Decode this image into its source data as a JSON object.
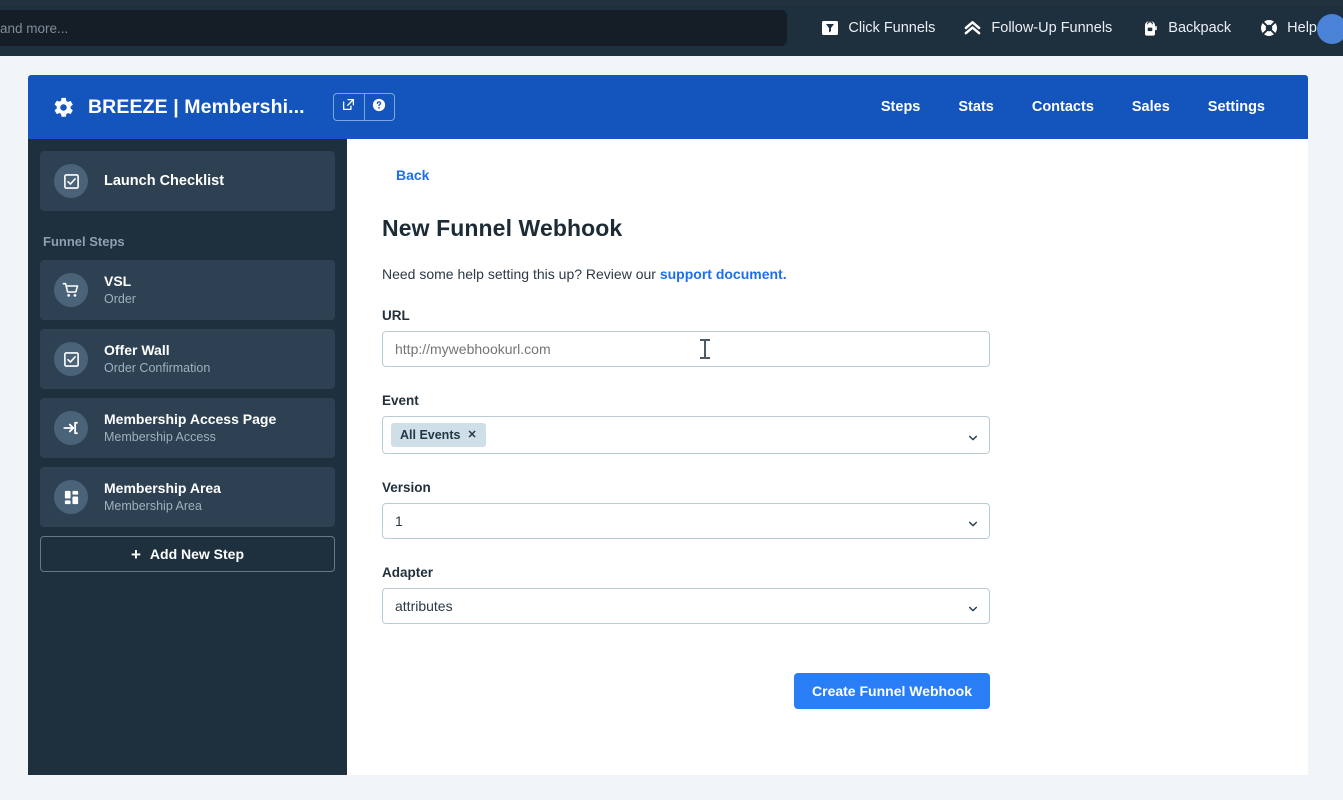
{
  "topbar": {
    "search_placeholder": "and more...",
    "search_value": "",
    "nav": [
      {
        "label": "Click Funnels",
        "icon": "clickfunnels-icon"
      },
      {
        "label": "Follow-Up Funnels",
        "icon": "chevrons-up-icon"
      },
      {
        "label": "Backpack",
        "icon": "backpack-icon"
      },
      {
        "label": "Help",
        "icon": "lifebuoy-icon"
      }
    ]
  },
  "appheader": {
    "title": "BREEZE | Membershi...",
    "gear_icon": "gear-icon",
    "buttons": [
      {
        "name": "open-external-button",
        "icon": "external-link-icon"
      },
      {
        "name": "help-button",
        "icon": "question-circle-icon"
      }
    ],
    "nav": [
      {
        "label": "Steps"
      },
      {
        "label": "Stats"
      },
      {
        "label": "Contacts"
      },
      {
        "label": "Sales"
      },
      {
        "label": "Settings"
      }
    ],
    "accent_color": "#1455bd"
  },
  "sidebar": {
    "launch_checklist": {
      "label": "Launch Checklist",
      "icon": "checkbox-icon"
    },
    "section_label": "Funnel Steps",
    "steps": [
      {
        "title": "VSL",
        "subtitle": "Order",
        "icon": "cart-icon"
      },
      {
        "title": "Offer Wall",
        "subtitle": "Order Confirmation",
        "icon": "checkbox-icon"
      },
      {
        "title": "Membership Access Page",
        "subtitle": "Membership Access",
        "icon": "sign-in-icon"
      },
      {
        "title": "Membership Area",
        "subtitle": "Membership Area",
        "icon": "grid-icon"
      }
    ],
    "add_step_label": "Add New Step",
    "add_step_icon": "plus-icon",
    "background_color": "#1e2f3e"
  },
  "main": {
    "back_label": "Back",
    "title": "New Funnel Webhook",
    "help_text": "Need some help setting this up? Review our ",
    "help_link": "support document.",
    "fields": {
      "url": {
        "label": "URL",
        "placeholder": "http://mywebhookurl.com",
        "value": ""
      },
      "event": {
        "label": "Event",
        "tag": "All Events",
        "tag_remove": "✕"
      },
      "version": {
        "label": "Version",
        "value": "1"
      },
      "adapter": {
        "label": "Adapter",
        "value": "attributes"
      }
    },
    "submit_label": "Create Funnel Webhook",
    "link_color": "#1f6feb",
    "submit_color": "#2a7ef5"
  }
}
